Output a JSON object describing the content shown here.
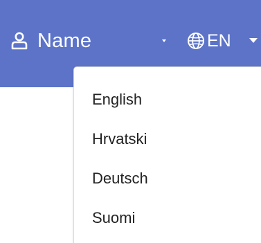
{
  "header": {
    "user_name": "Name",
    "language_current": "EN",
    "background": "#5C73C8"
  },
  "icons": {
    "user": "user-icon",
    "globe": "globe-icon",
    "caret": "chevron-down-icon"
  },
  "language_menu": {
    "items": [
      "English",
      "Hrvatski",
      "Deutsch",
      "Suomi"
    ]
  }
}
